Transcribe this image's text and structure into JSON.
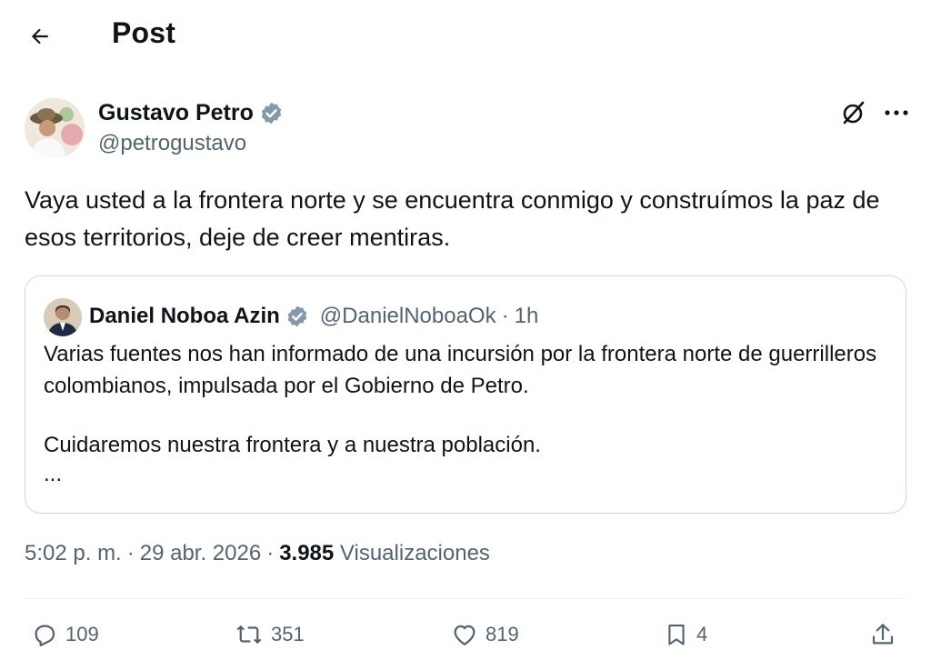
{
  "header": {
    "title": "Post",
    "back_icon": "arrow-left-icon"
  },
  "author": {
    "name": "Gustavo Petro",
    "handle": "@petrogustavo",
    "verified": true,
    "verified_color": "#829aab"
  },
  "post": {
    "text": "Vaya usted a la frontera norte y se encuentra conmigo y construímos la paz de esos territorios, deje de creer mentiras."
  },
  "quote": {
    "name": "Daniel Noboa Azin",
    "handle": "@DanielNoboaOk",
    "separator": "·",
    "time": "1h",
    "paragraphs": [
      "Varias fuentes nos han informado de una incursión por la frontera norte de guerrilleros colombianos, impulsada por el Gobierno de Petro.",
      "Cuidaremos nuestra frontera y a nuestra población."
    ],
    "ellipsis": "..."
  },
  "meta": {
    "time": "5:02 p. m.",
    "dot1": "·",
    "date": "29 abr. 2026",
    "dot2": "·",
    "views": "3.985",
    "views_label": "Visualizaciones"
  },
  "actions": {
    "replies": "109",
    "reposts": "351",
    "likes": "819",
    "bookmarks": "4"
  },
  "colors": {
    "text": "#0f1419",
    "secondary": "#536471",
    "border": "#cfd9de"
  }
}
